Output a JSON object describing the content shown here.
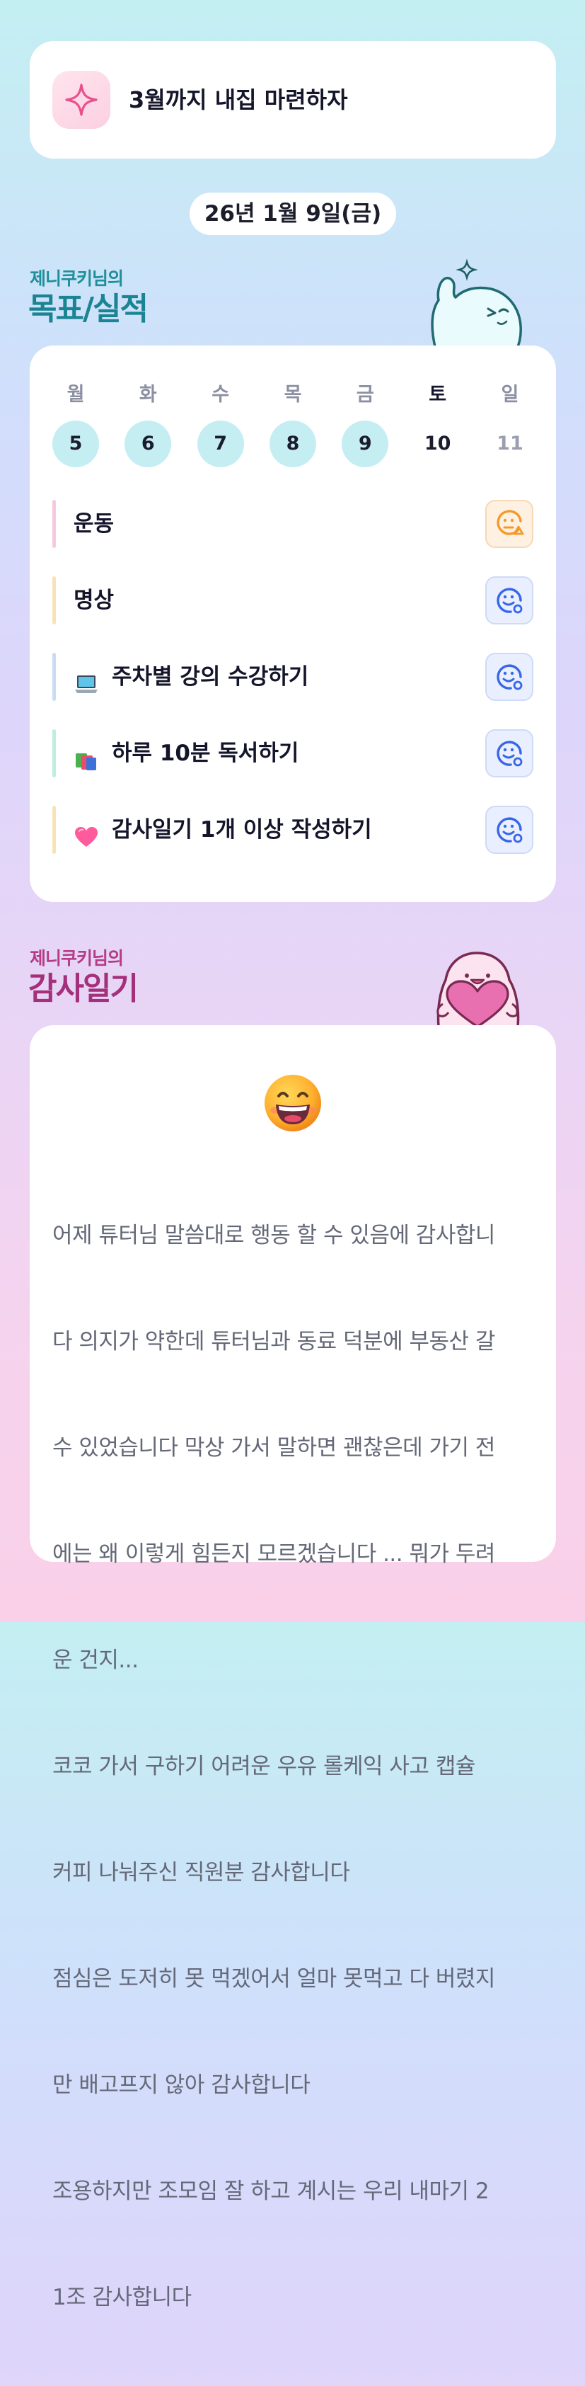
{
  "goal": {
    "icon": "sparkle-icon",
    "text": "3월까지 내집 마련하자"
  },
  "date_label": "26년 1월 9일(금)",
  "goals_section": {
    "owner": "제니쿠키님의",
    "title": "목표/실적"
  },
  "week": [
    {
      "name": "월",
      "num": "5",
      "state": "done"
    },
    {
      "name": "화",
      "num": "6",
      "state": "done"
    },
    {
      "name": "수",
      "num": "7",
      "state": "done"
    },
    {
      "name": "목",
      "num": "8",
      "state": "done"
    },
    {
      "name": "금",
      "num": "9",
      "state": "done"
    },
    {
      "name": "토",
      "num": "10",
      "state": "today"
    },
    {
      "name": "일",
      "num": "11",
      "state": "future"
    }
  ],
  "goals": [
    {
      "label": "운동",
      "emoji": "",
      "bar_color": "#f5c9df",
      "status": "warning-face-icon"
    },
    {
      "label": "명상",
      "emoji": "",
      "bar_color": "#f8e3b8",
      "status": "smile-face-icon"
    },
    {
      "label": "주차별 강의 수강하기",
      "emoji": "laptop-icon",
      "bar_color": "#c9dcf4",
      "status": "smile-face-icon"
    },
    {
      "label": "하루 10분 독서하기",
      "emoji": "books-icon",
      "bar_color": "#bfeede",
      "status": "smile-face-icon"
    },
    {
      "label": "감사일기 1개 이상 작성하기",
      "emoji": "heart-icon",
      "bar_color": "#f8e3b8",
      "status": "smile-face-icon"
    }
  ],
  "diary_section": {
    "owner": "제니쿠키님의",
    "title": "감사일기"
  },
  "diary": {
    "emoji": "grinning-face-icon",
    "lines": [
      "어제 튜터님 말씀대로 행동 할 수 있음에 감사합니",
      "다 의지가 약한데 튜터님과 동료 덕분에 부동산 갈",
      "수 있었습니다 막상 가서 말하면 괜찮은데 가기 전",
      "에는 왜 이렇게 힘든지 모르겠습니다 ... 뭐가 두려",
      "운 건지...",
      "코코 가서 구하기 어려운 우유 롤케익 사고 캡슐",
      "커피 나눠주신 직원분 감사합니다",
      "점심은 도저히 못 먹겠어서 얼마 못먹고 다 버렸지",
      "만 배고프지 않아 감사합니다",
      "조용하지만 조모임 잘 하고 계시는 우리 내마기 2",
      "1조 감사합니다"
    ]
  },
  "colors": {
    "accent_teal": "#1b8493",
    "accent_pink": "#a42f7a",
    "done_day": "#c5eef3",
    "status_orange": "#f59a2a",
    "status_blue": "#3766e8"
  }
}
